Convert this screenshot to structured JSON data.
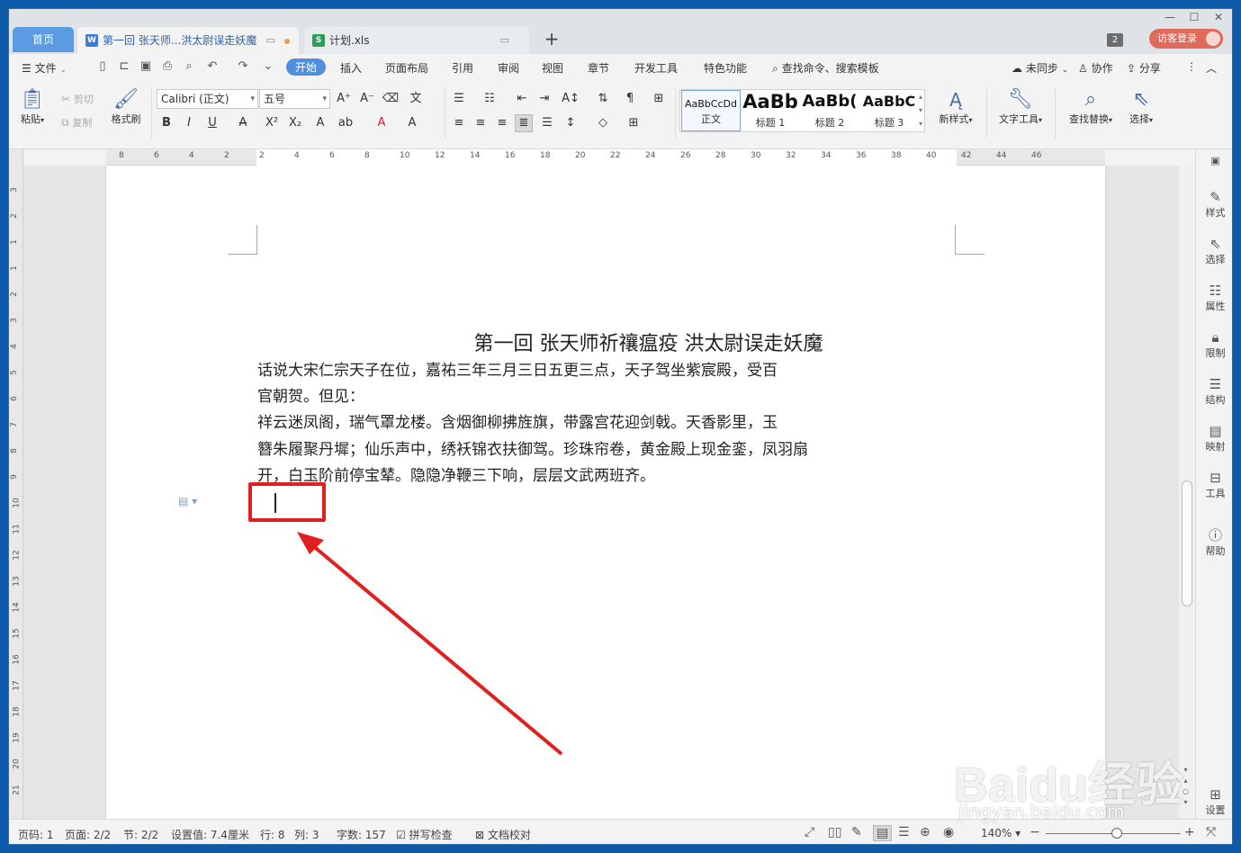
{
  "tabs": {
    "home": "首页",
    "doc_tab": "第一回 张天师...洪太尉误走妖魔",
    "xls_tab": "计划.xls",
    "add": "+",
    "window_count": "2",
    "login": "访客登录"
  },
  "menu": {
    "file": "文件",
    "items": [
      "开始",
      "插入",
      "页面布局",
      "引用",
      "审阅",
      "视图",
      "章节",
      "开发工具",
      "特色功能"
    ],
    "search": "查找命令、搜索模板",
    "sync": "未同步",
    "collab": "协作",
    "share": "分享"
  },
  "ribbon": {
    "paste": "粘贴",
    "cut": "剪切",
    "copy": "复制",
    "format_painter": "格式刷",
    "font": "Calibri (正文)",
    "size": "五号",
    "styles": [
      {
        "preview": "AaBbCcDd",
        "name": "正文"
      },
      {
        "preview": "AaBb",
        "name": "标题 1"
      },
      {
        "preview": "AaBb(",
        "name": "标题 2"
      },
      {
        "preview": "AaBbC",
        "name": "标题 3"
      }
    ],
    "new_style": "新样式",
    "text_tools": "文字工具",
    "find_replace": "查找替换",
    "select": "选择"
  },
  "ruler": {
    "h_ticks": [
      "8",
      "6",
      "4",
      "2",
      "2",
      "4",
      "6",
      "8",
      "10",
      "12",
      "14",
      "16",
      "18",
      "20",
      "22",
      "24",
      "26",
      "28",
      "30",
      "32",
      "34",
      "36",
      "38",
      "40",
      "42",
      "44",
      "46"
    ],
    "v_ticks": [
      "3",
      "2",
      "1",
      "1",
      "2",
      "3",
      "4",
      "5",
      "6",
      "7",
      "8",
      "9",
      "10",
      "11",
      "12",
      "13",
      "14",
      "15",
      "16",
      "17",
      "18",
      "19",
      "20",
      "21"
    ]
  },
  "document": {
    "title": "第一回  张天师祈禳瘟疫    洪太尉误走妖魔",
    "lines": [
      "话说大宋仁宗天子在位，嘉祐三年三月三日五更三点，天子驾坐紫宸殿，受百",
      "官朝贺。但见：",
      "    祥云迷凤阁，瑞气罩龙楼。含烟御柳拂旌旗，带露宫花迎剑戟。天香影里，玉",
      "簪朱履聚丹墀；仙乐声中，绣袄锦衣扶御驾。珍珠帘卷，黄金殿上现金銮，凤羽扇",
      "开，白玉阶前停宝辇。隐隐净鞭三下响，层层文武两班齐。"
    ]
  },
  "sidebar": [
    "样式",
    "选择",
    "属性",
    "限制",
    "结构",
    "映射",
    "工具",
    "帮助",
    "设置"
  ],
  "status": {
    "page_no": "页码: 1",
    "pages": "页面: 2/2",
    "section": "节: 2/2",
    "setting": "设置值: 7.4厘米",
    "row": "行: 8",
    "col": "列: 3",
    "words": "字数: 157",
    "spell": "拼写检查",
    "proof": "文档校对",
    "zoom": "140%"
  },
  "watermark": {
    "logo": "Baidu经验",
    "url": "jingyan.baidu.com"
  },
  "colors": {
    "accent": "#4f8fe0",
    "highlight": "#e21f1f",
    "login": "#e06b5c"
  }
}
